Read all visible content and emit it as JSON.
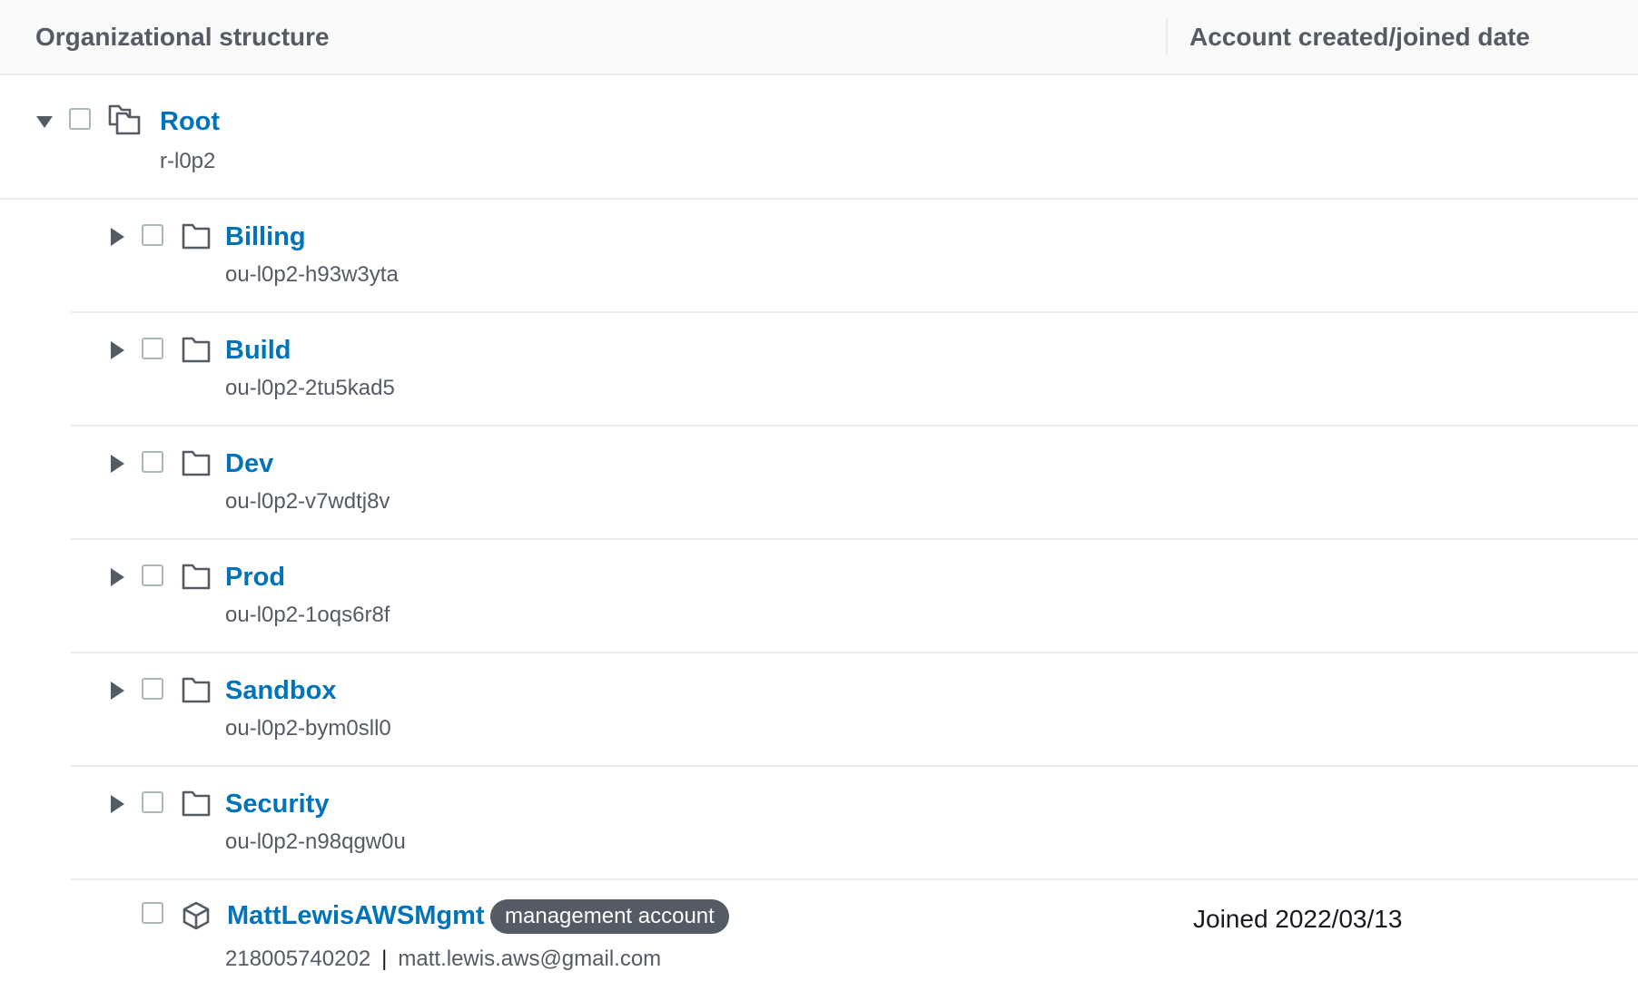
{
  "header": {
    "col_structure": "Organizational structure",
    "col_joined": "Account created/joined date"
  },
  "root": {
    "name": "Root",
    "id": "r-l0p2",
    "expanded": true,
    "icon": "root-stack-icon"
  },
  "ous": [
    {
      "name": "Billing",
      "id": "ou-l0p2-h93w3yta",
      "icon": "folder-icon",
      "expanded": false
    },
    {
      "name": "Build",
      "id": "ou-l0p2-2tu5kad5",
      "icon": "folder-icon",
      "expanded": false
    },
    {
      "name": "Dev",
      "id": "ou-l0p2-v7wdtj8v",
      "icon": "folder-icon",
      "expanded": false
    },
    {
      "name": "Prod",
      "id": "ou-l0p2-1oqs6r8f",
      "icon": "folder-icon",
      "expanded": false
    },
    {
      "name": "Sandbox",
      "id": "ou-l0p2-bym0sll0",
      "icon": "folder-icon",
      "expanded": false
    },
    {
      "name": "Security",
      "id": "ou-l0p2-n98qgw0u",
      "icon": "folder-icon",
      "expanded": false
    }
  ],
  "account": {
    "name": "MattLewisAWSMgmt",
    "badge": "management account",
    "account_id": "218005740202",
    "separator": "|",
    "email": "matt.lewis.aws@gmail.com",
    "joined": "Joined 2022/03/13",
    "icon": "account-cube-icon"
  },
  "colors": {
    "link": "#0073bb",
    "secondary_text": "#545b64",
    "badge_bg": "#545b64",
    "border": "#eaeded"
  }
}
